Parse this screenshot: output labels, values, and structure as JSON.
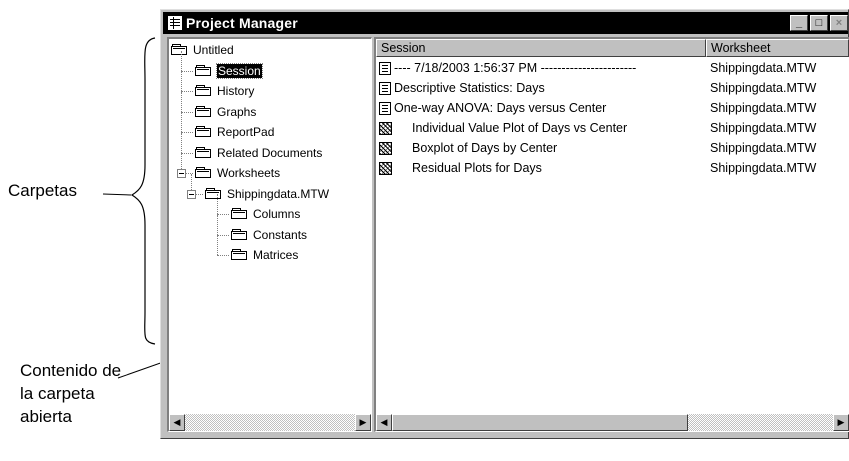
{
  "annotations": {
    "carpetas": "Carpetas",
    "contenido": "Contenido de la carpeta abierta"
  },
  "window": {
    "title": "Project Manager",
    "buttons": {
      "minimize": "_",
      "maximize": "□",
      "close": "×"
    }
  },
  "tree": {
    "items": [
      {
        "label": "Untitled",
        "level": 0
      },
      {
        "label": "Session",
        "level": 1,
        "selected": true
      },
      {
        "label": "History",
        "level": 1
      },
      {
        "label": "Graphs",
        "level": 1
      },
      {
        "label": "ReportPad",
        "level": 1
      },
      {
        "label": "Related Documents",
        "level": 1
      },
      {
        "label": "Worksheets",
        "level": 1,
        "expanded": true
      },
      {
        "label": "Shippingdata.MTW",
        "level": 2,
        "expanded": true
      },
      {
        "label": "Columns",
        "level": 3
      },
      {
        "label": "Constants",
        "level": 3
      },
      {
        "label": "Matrices",
        "level": 3
      }
    ]
  },
  "list": {
    "columns": [
      "Session",
      "Worksheet"
    ],
    "rows": [
      {
        "icon": "document-icon",
        "session": "----   7/18/2003 1:56:37 PM   -----------------------",
        "worksheet": "Shippingdata.MTW"
      },
      {
        "icon": "document-icon",
        "session": "Descriptive Statistics: Days",
        "worksheet": "Shippingdata.MTW"
      },
      {
        "icon": "document-icon",
        "session": "One-way ANOVA: Days versus Center",
        "worksheet": "Shippingdata.MTW"
      },
      {
        "icon": "graph-icon",
        "session": "Individual Value Plot of Days vs Center",
        "worksheet": "Shippingdata.MTW"
      },
      {
        "icon": "graph-icon",
        "session": "Boxplot of Days by Center",
        "worksheet": "Shippingdata.MTW"
      },
      {
        "icon": "graph-icon",
        "session": "Residual Plots for Days",
        "worksheet": "Shippingdata.MTW"
      }
    ]
  },
  "scrollbars": {
    "left_arrow": "◀",
    "right_arrow": "▶"
  }
}
